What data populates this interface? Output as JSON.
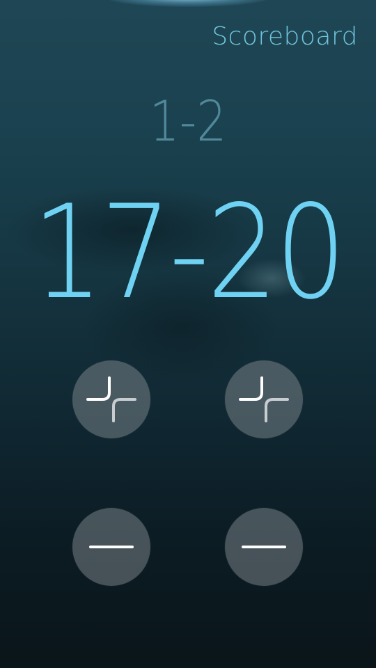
{
  "header": {
    "title": "Scoreboard"
  },
  "score": {
    "sets": "1-2",
    "points": "17-20"
  },
  "controls": {
    "left_plus_icon": "plus-icon",
    "right_plus_icon": "plus-icon",
    "left_minus_icon": "minus-icon",
    "right_minus_icon": "minus-icon"
  },
  "colors": {
    "accent": "#6fd2f2",
    "header": "#6fc4dc",
    "button_bg": "#788287"
  }
}
